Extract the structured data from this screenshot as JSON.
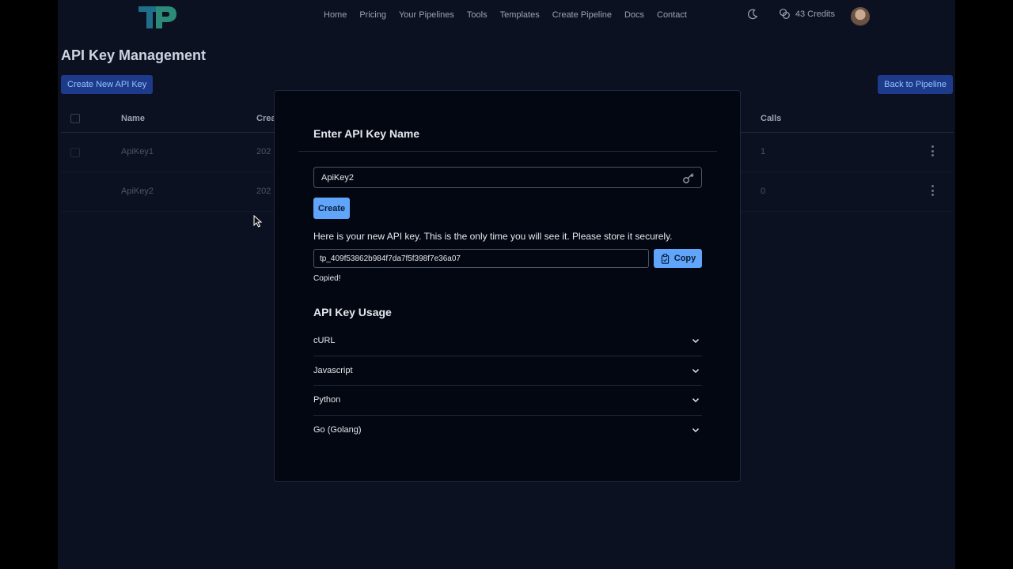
{
  "nav": {
    "links": [
      "Home",
      "Pricing",
      "Your Pipelines",
      "Tools",
      "Templates",
      "Create Pipeline",
      "Docs",
      "Contact"
    ],
    "credits": "43 Credits",
    "theme_icon": "moon-icon",
    "credits_icon": "coins-icon"
  },
  "page": {
    "title": "API Key Management",
    "create_new_label": "Create New API Key",
    "back_label": "Back to Pipeline"
  },
  "table": {
    "headers": {
      "name": "Name",
      "created": "Crea",
      "calls": "Calls"
    },
    "rows": [
      {
        "name": "ApiKey1",
        "created": "202",
        "calls": "1"
      },
      {
        "name": "ApiKey2",
        "created": "202",
        "calls": "0"
      }
    ]
  },
  "modal": {
    "title": "Enter API Key Name",
    "name_value": "ApiKey2",
    "create_label": "Create",
    "notice": "Here is your new API key. This is the only time you will see it. Please store it securely.",
    "api_key": "tp_409f53862b984f7da7f5f398f7e36a07",
    "copy_label": "Copy",
    "copied_text": "Copied!",
    "usage_title": "API Key Usage",
    "usage_items": [
      "cURL",
      "Javascript",
      "Python",
      "Go (Golang)"
    ]
  },
  "colors": {
    "accent": "#60a5fa",
    "background": "#0b1120",
    "modal_bg": "#030712"
  }
}
